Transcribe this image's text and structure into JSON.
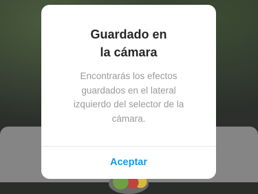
{
  "dialog": {
    "title_lines": [
      "Guardado en",
      "la cámara"
    ],
    "message_lines": [
      "Encontrarás los efectos",
      "guardados en el lateral",
      "izquierdo del selector de la",
      "cámara."
    ],
    "accept_label": "Aceptar"
  },
  "colors": {
    "accent": "#1a98e6",
    "title": "#262626",
    "message": "#9a9a9a",
    "overlay_sheet": "#858585"
  }
}
